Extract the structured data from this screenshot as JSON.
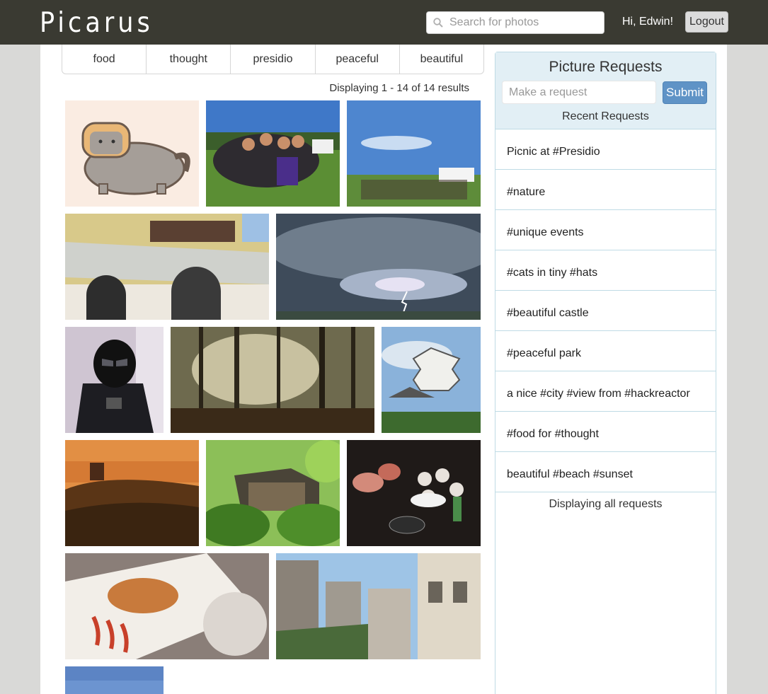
{
  "header": {
    "logo": "Picarus",
    "search": {
      "placeholder": "Search for photos",
      "value": ""
    },
    "greeting": "Hi, Edwin!",
    "logout_label": "Logout"
  },
  "tags": [
    "food",
    "thought",
    "presidio",
    "peaceful",
    "beautiful"
  ],
  "results": {
    "summary": "Displaying 1 - 14 of 14 results"
  },
  "photos": [
    {
      "subject": "pusheen cat with toast"
    },
    {
      "subject": "group photo in park"
    },
    {
      "subject": "picnic crowd in park"
    },
    {
      "subject": "building entrance with awning"
    },
    {
      "subject": "storm clouds with lightning"
    },
    {
      "subject": "darth vader costume"
    },
    {
      "subject": "misty forest sunbeams"
    },
    {
      "subject": "japanese castle"
    },
    {
      "subject": "castle on hill at sunset"
    },
    {
      "subject": "japanese garden"
    },
    {
      "subject": "korean barbecue table"
    },
    {
      "subject": "plated fried dish"
    },
    {
      "subject": "city street view"
    },
    {
      "subject": "blue sky"
    }
  ],
  "sidebar": {
    "title": "Picture Requests",
    "request_placeholder": "Make a request",
    "submit_label": "Submit",
    "recent_label": "Recent Requests",
    "requests": [
      "Picnic at #Presidio",
      "#nature",
      "#unique events",
      "#cats in tiny #hats",
      "#beautiful castle",
      "#peaceful park",
      "a nice #city #view from #hackreactor",
      "#food for #thought",
      "beautiful #beach #sunset"
    ],
    "footer": "Displaying all requests"
  },
  "colors": {
    "header_bg": "#3a3a32",
    "sidebar_head_bg": "#e2eff5",
    "submit_bg": "#5f93c6",
    "page_bg": "#d9d9d7"
  }
}
